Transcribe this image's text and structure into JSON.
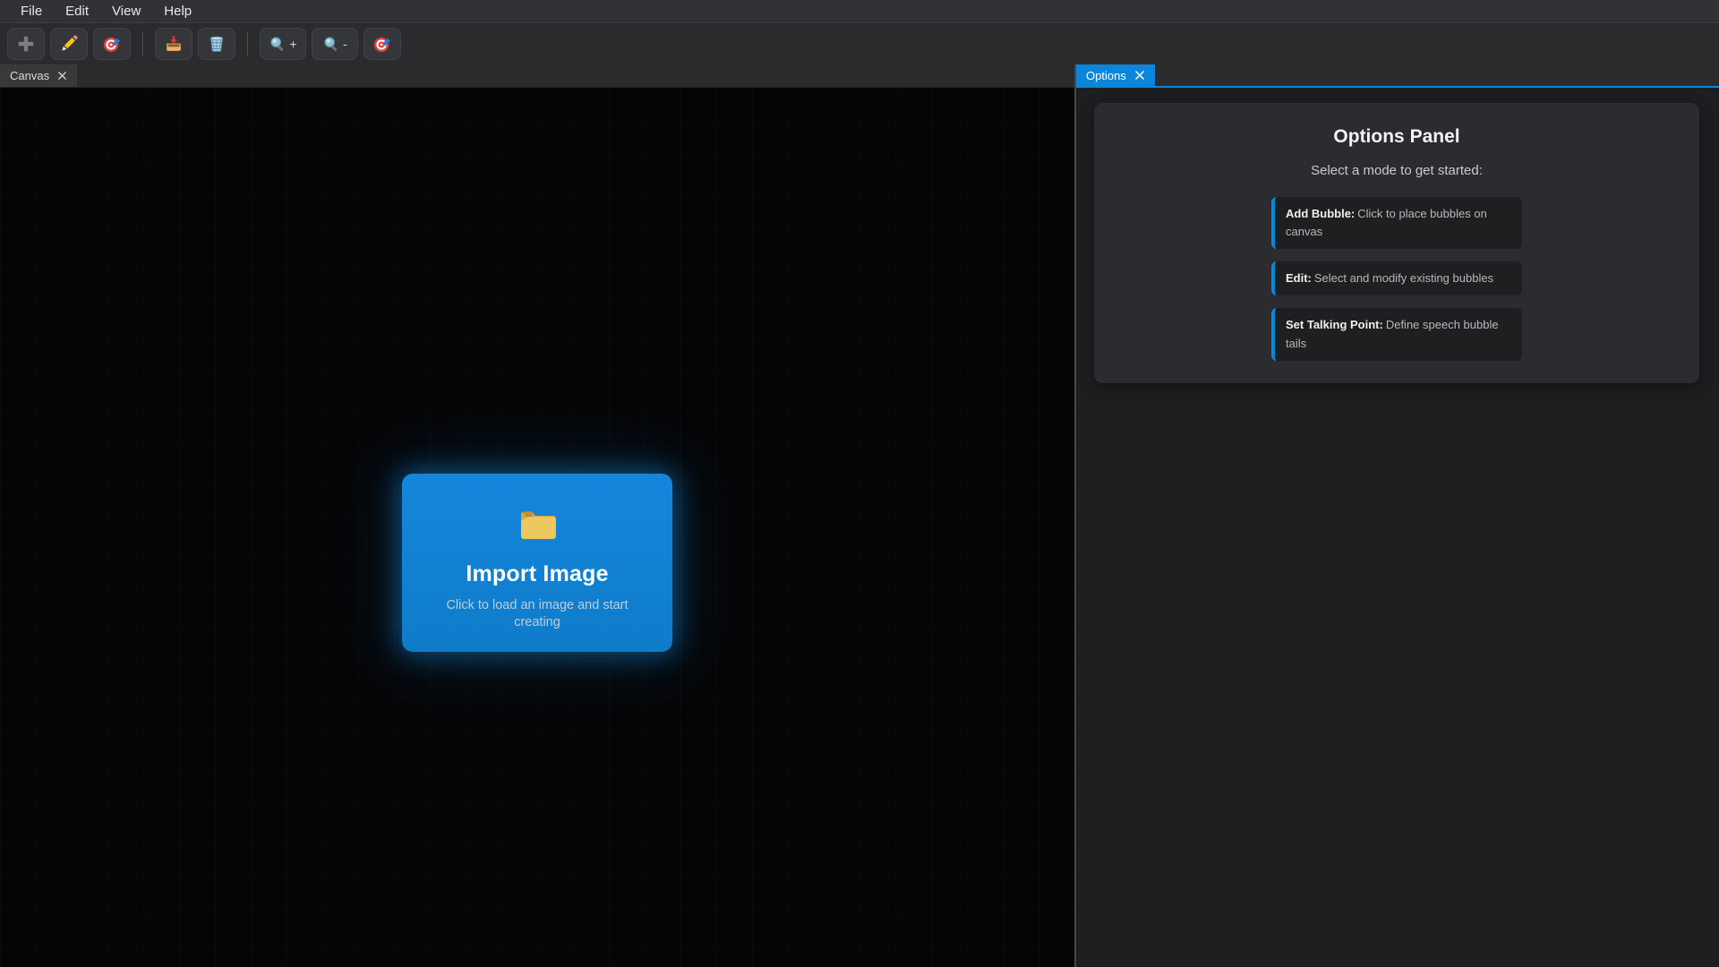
{
  "menu": {
    "items": [
      "File",
      "Edit",
      "View",
      "Help"
    ]
  },
  "toolbar": {
    "zoom_in_suffix": "+",
    "zoom_out_suffix": "-"
  },
  "tabs": {
    "canvas": {
      "label": "Canvas"
    },
    "options": {
      "label": "Options"
    }
  },
  "canvas": {
    "import_card": {
      "title": "Import Image",
      "subtitle": "Click to load an image and start creating"
    }
  },
  "options_panel": {
    "title": "Options Panel",
    "subtitle": "Select a mode to get started:",
    "modes": [
      {
        "label": "Add Bubble:",
        "description": "Click to place bubbles on canvas"
      },
      {
        "label": "Edit:",
        "description": "Select and modify existing bubbles"
      },
      {
        "label": "Set Talking Point:",
        "description": "Define speech bubble tails"
      }
    ]
  },
  "colors": {
    "accent": "#0b86da",
    "import_card": "#0f7cca"
  }
}
